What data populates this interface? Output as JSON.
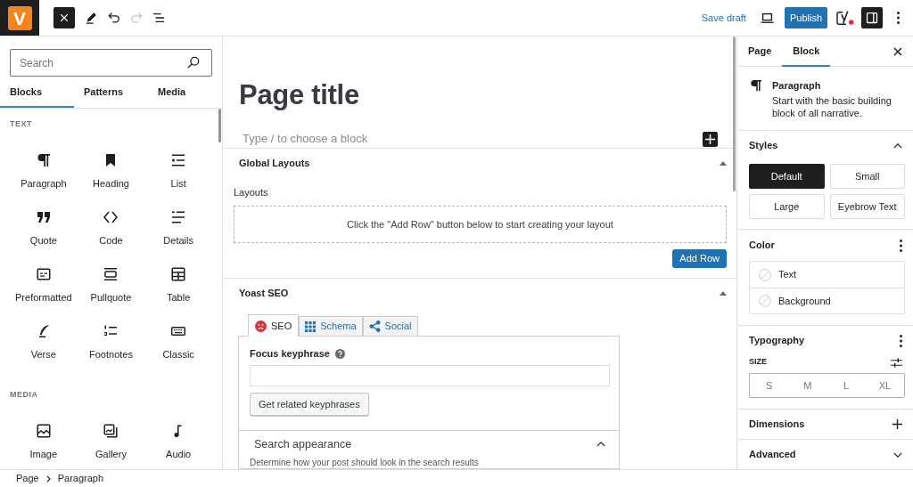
{
  "top_bar": {
    "logo": "V",
    "tools": [
      {
        "kind": "close",
        "pressed": true,
        "disabled": false
      },
      {
        "kind": "edit",
        "pressed": false,
        "disabled": false
      },
      {
        "kind": "undo",
        "pressed": false,
        "disabled": false
      },
      {
        "kind": "redo",
        "pressed": false,
        "disabled": true
      },
      {
        "kind": "list_view",
        "pressed": false,
        "disabled": false
      }
    ],
    "save_draft": "Save draft",
    "publish": "Publish",
    "settings_pressed": true
  },
  "inserter": {
    "search": {
      "placeholder": "Search"
    },
    "tabs": [
      {
        "label": "Blocks",
        "selected": true
      },
      {
        "label": "Patterns",
        "selected": false
      },
      {
        "label": "Media",
        "selected": false
      }
    ],
    "categories": [
      {
        "title": "TEXT",
        "blocks": [
          {
            "kind": "paragraph",
            "label": "Paragraph"
          },
          {
            "kind": "heading",
            "label": "Heading"
          },
          {
            "kind": "list",
            "label": "List"
          },
          {
            "kind": "quote",
            "label": "Quote"
          },
          {
            "kind": "code",
            "label": "Code"
          },
          {
            "kind": "details",
            "label": "Details"
          },
          {
            "kind": "preformatted",
            "label": "Preformatted"
          },
          {
            "kind": "pullquote",
            "label": "Pullquote"
          },
          {
            "kind": "table",
            "label": "Table"
          },
          {
            "kind": "verse",
            "label": "Verse"
          },
          {
            "kind": "footnotes",
            "label": "Footnotes"
          },
          {
            "kind": "classic",
            "label": "Classic"
          }
        ]
      },
      {
        "title": "MEDIA",
        "blocks": [
          {
            "kind": "image",
            "label": "Image"
          },
          {
            "kind": "gallery",
            "label": "Gallery"
          },
          {
            "kind": "audio",
            "label": "Audio"
          }
        ]
      }
    ]
  },
  "editor": {
    "title": "Page title",
    "placeholder": "Type / to choose a block"
  },
  "meta_boxes": [
    {
      "kind": "layouts",
      "title": "Global Layouts",
      "expanded": true,
      "label": "Layouts",
      "empty_message": "Click the \"Add Row\" button below to start creating your layout",
      "button": "Add Row"
    },
    {
      "kind": "seo",
      "title": "Yoast SEO",
      "expanded": true,
      "tabs": [
        {
          "kind": "seo",
          "label": "SEO",
          "selected": true
        },
        {
          "kind": "schema",
          "label": "Schema",
          "selected": false
        },
        {
          "kind": "social",
          "label": "Social",
          "selected": false
        }
      ],
      "field_label": "Focus keyphrase",
      "button": "Get related keyphrases",
      "section": {
        "title": "Search appearance",
        "expanded": true,
        "description": "Determine how your post should look in the search results"
      }
    }
  ],
  "sidebar": {
    "tabs": [
      {
        "label": "Page",
        "selected": false
      },
      {
        "label": "Block",
        "selected": true
      }
    ],
    "block": {
      "title": "Paragraph",
      "description": "Start with the basic building block of all narrative."
    },
    "panels": [
      {
        "kind": "styles",
        "title": "Styles",
        "expanded": true,
        "options": [
          {
            "label": "Default",
            "selected": true
          },
          {
            "label": "Small",
            "selected": false
          },
          {
            "label": "Large",
            "selected": false
          },
          {
            "label": "Eyebrow Text",
            "selected": false
          }
        ]
      },
      {
        "kind": "color",
        "title": "Color",
        "items": [
          "Text",
          "Background"
        ]
      },
      {
        "kind": "typography",
        "title": "Typography",
        "size_label": "SIZE",
        "sizes": [
          "S",
          "M",
          "L",
          "XL"
        ]
      },
      {
        "kind": "add",
        "title": "Dimensions"
      },
      {
        "kind": "collapsible",
        "title": "Advanced",
        "expanded": false
      }
    ]
  },
  "breadcrumb": [
    "Page",
    "Paragraph"
  ]
}
